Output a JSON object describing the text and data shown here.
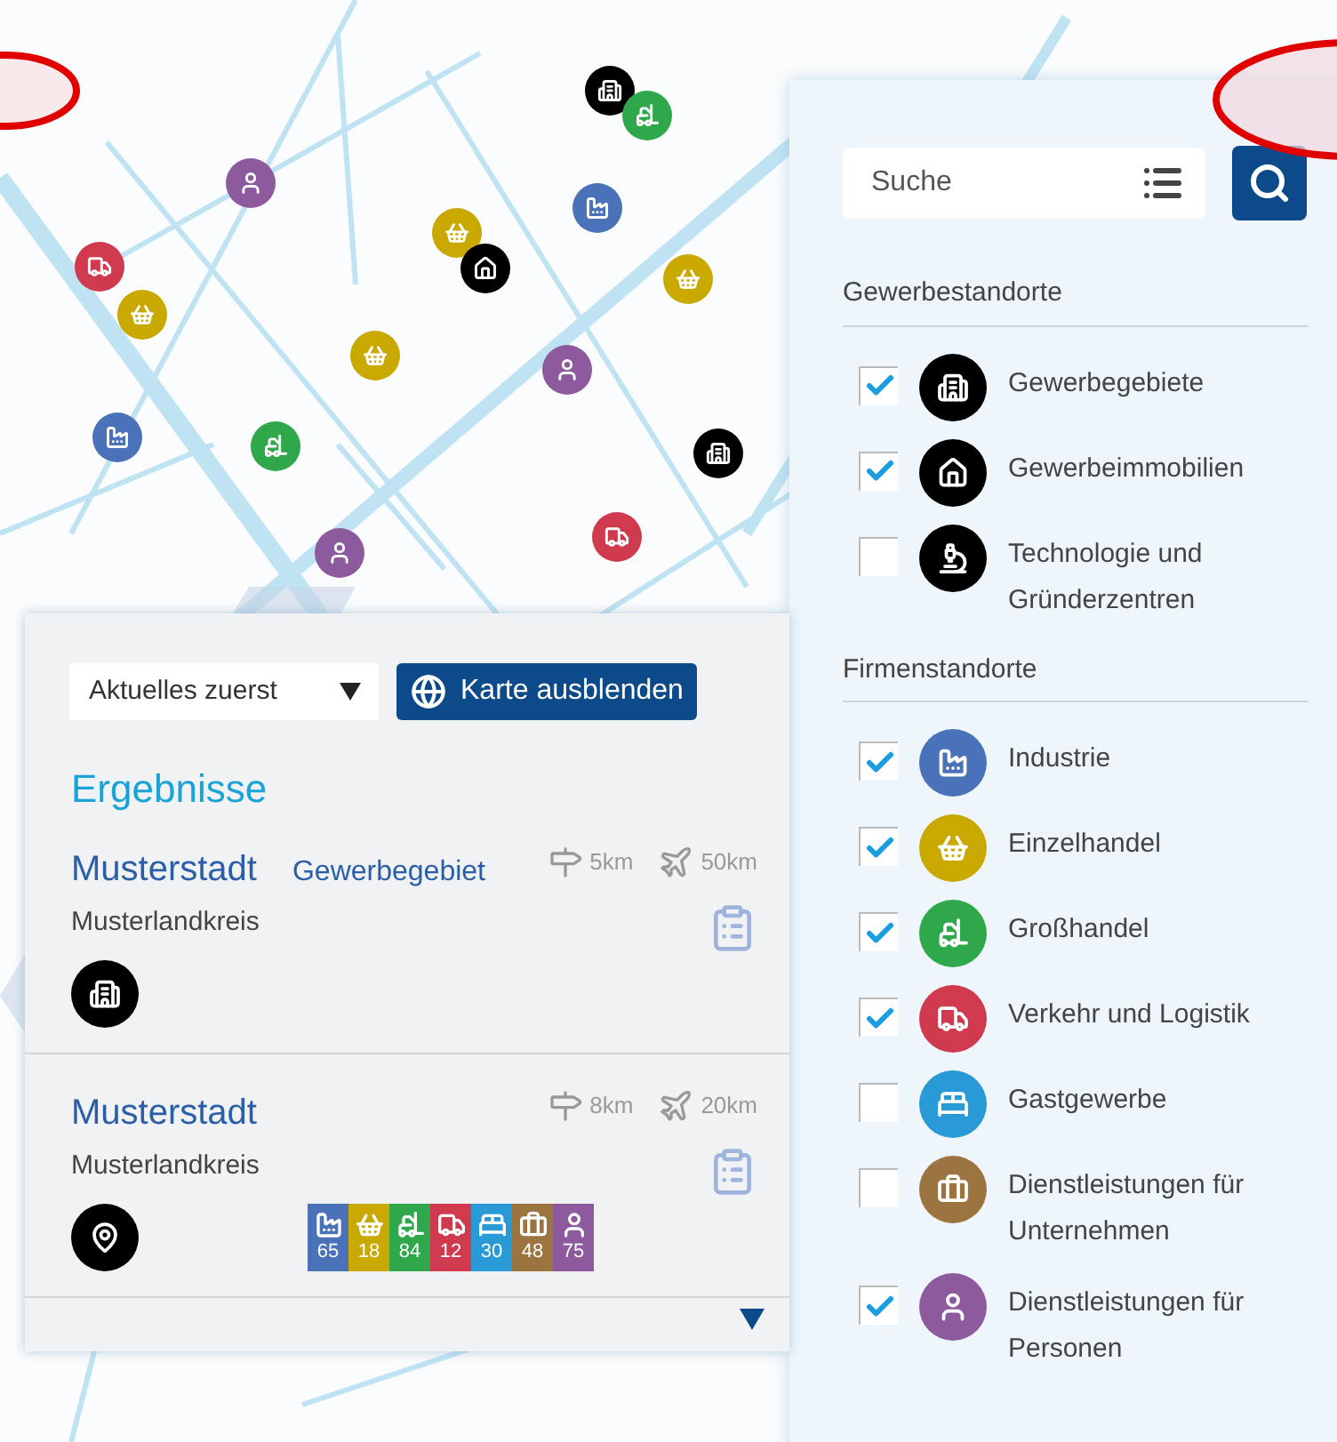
{
  "map": {
    "pins": [
      {
        "kind": "gewerbegebiet",
        "color": "#000000"
      },
      {
        "kind": "grosshandel",
        "color": "#2ea84a"
      },
      {
        "kind": "personen",
        "color": "#8e5a9e"
      },
      {
        "kind": "verkehr",
        "color": "#cf3a4e"
      },
      {
        "kind": "einzelhandel",
        "color": "#c9a800"
      },
      {
        "kind": "einzelhandel",
        "color": "#c9a800"
      },
      {
        "kind": "gewerbeimmobilie",
        "color": "#000000"
      },
      {
        "kind": "industrie",
        "color": "#4a72b8"
      },
      {
        "kind": "einzelhandel",
        "color": "#c9a800"
      },
      {
        "kind": "einzelhandel",
        "color": "#c9a800"
      },
      {
        "kind": "personen",
        "color": "#8e5a9e"
      },
      {
        "kind": "industrie",
        "color": "#4a72b8"
      },
      {
        "kind": "grosshandel",
        "color": "#2ea84a"
      },
      {
        "kind": "gewerbegebiet",
        "color": "#000000"
      },
      {
        "kind": "personen",
        "color": "#8e5a9e"
      },
      {
        "kind": "verkehr",
        "color": "#cf3a4e"
      }
    ]
  },
  "search": {
    "placeholder": "Suche"
  },
  "filters": [
    {
      "title": "Gewerbestandorte",
      "items": [
        {
          "label": "Gewerbegebiete",
          "kind": "gewerbegebiet",
          "color": "#000000",
          "checked": true
        },
        {
          "label": "Gewerbeimmobilien",
          "kind": "gewerbeimmobilie",
          "color": "#000000",
          "checked": true
        },
        {
          "label": "Technologie und Gründerzentren",
          "kind": "technologie",
          "color": "#000000",
          "checked": false
        }
      ]
    },
    {
      "title": "Firmenstandorte",
      "items": [
        {
          "label": "Industrie",
          "kind": "industrie",
          "color": "#4a72b8",
          "checked": true
        },
        {
          "label": "Einzelhandel",
          "kind": "einzelhandel",
          "color": "#c9a800",
          "checked": true
        },
        {
          "label": "Großhandel",
          "kind": "grosshandel",
          "color": "#2ea84a",
          "checked": true
        },
        {
          "label": "Verkehr und Logistik",
          "kind": "verkehr",
          "color": "#cf3a4e",
          "checked": true
        },
        {
          "label": "Gastgewerbe",
          "kind": "gastgewerbe",
          "color": "#2a9ad6",
          "checked": false
        },
        {
          "label": "Dienstleistungen für Unternehmen",
          "kind": "unternehmen",
          "color": "#9c7440",
          "checked": false
        },
        {
          "label": "Dienstleistungen für Personen",
          "kind": "personen",
          "color": "#8e5a9e",
          "checked": true
        }
      ]
    }
  ],
  "results": {
    "sort": "Aktuelles zuerst",
    "toggle_button": "Karte ausblenden",
    "title": "Ergebnisse",
    "items": [
      {
        "city": "Musterstadt",
        "type": "Gewerbegebiet",
        "district": "Musterlandkreis",
        "highway": "5km",
        "airport": "50km",
        "kind": "gewerbegebiet"
      },
      {
        "city": "Musterstadt",
        "district": "Musterlandkreis",
        "highway": "8km",
        "airport": "20km",
        "kind": "standort",
        "counts": [
          {
            "kind": "industrie",
            "color": "#4a72b8",
            "value": "65"
          },
          {
            "kind": "einzelhandel",
            "color": "#c9a800",
            "value": "18"
          },
          {
            "kind": "grosshandel",
            "color": "#2ea84a",
            "value": "84"
          },
          {
            "kind": "verkehr",
            "color": "#cf3a4e",
            "value": "12"
          },
          {
            "kind": "gastgewerbe",
            "color": "#2a9ad6",
            "value": "30"
          },
          {
            "kind": "unternehmen",
            "color": "#9c7440",
            "value": "48"
          },
          {
            "kind": "personen",
            "color": "#8e5a9e",
            "value": "75"
          }
        ]
      }
    ]
  }
}
